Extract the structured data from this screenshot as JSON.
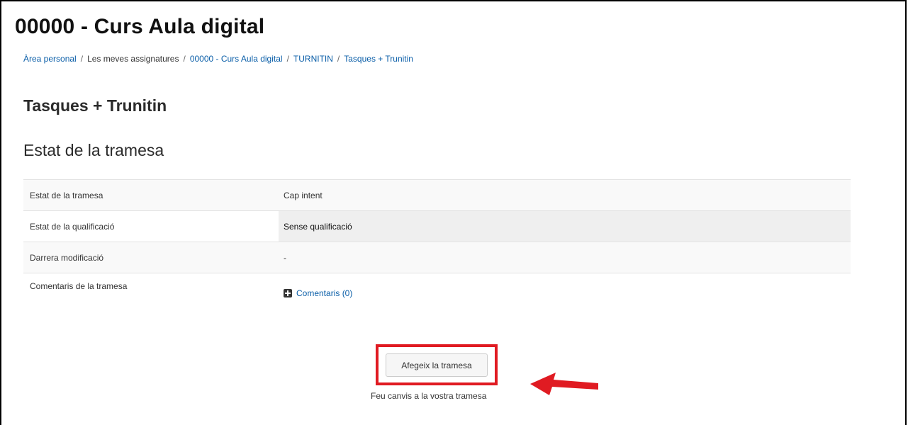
{
  "course": {
    "title": "00000 - Curs Aula digital"
  },
  "breadcrumb": [
    {
      "label": "Àrea personal",
      "link": true
    },
    {
      "label": "Les meves assignatures",
      "link": false
    },
    {
      "label": "00000 - Curs Aula digital",
      "link": true
    },
    {
      "label": "TURNITIN",
      "link": true
    },
    {
      "label": "Tasques + Trunitin",
      "link": true
    }
  ],
  "activity": {
    "title": "Tasques + Trunitin"
  },
  "submission_status": {
    "heading": "Estat de la tramesa",
    "rows": [
      {
        "label": "Estat de la tramesa",
        "value": "Cap intent"
      },
      {
        "label": "Estat de la qualificació",
        "value": "Sense qualificació"
      },
      {
        "label": "Darrera modificació",
        "value": "-"
      },
      {
        "label": "Comentaris de la tramesa",
        "value": "Comentaris (0)"
      }
    ]
  },
  "actions": {
    "add_submission_label": "Afegeix la tramesa",
    "help_text": "Feu canvis a la vostra tramesa"
  },
  "annotation": {
    "highlight_color": "#e01b22",
    "arrow_icon": "arrow-left-icon"
  }
}
